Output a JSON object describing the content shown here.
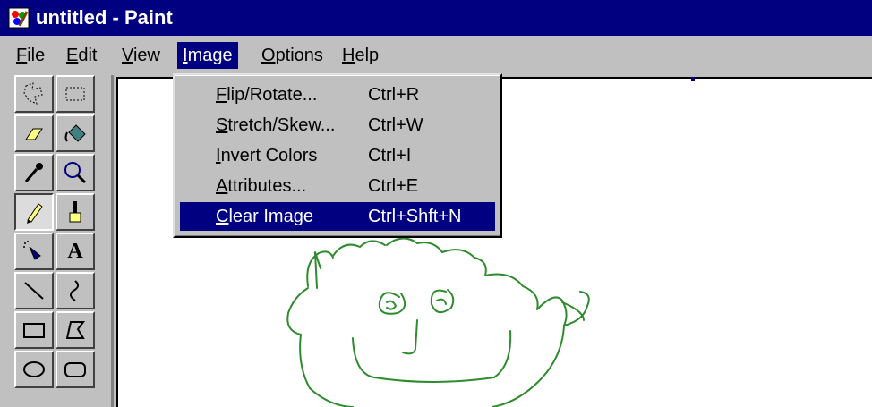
{
  "window": {
    "title": "untitled - Paint"
  },
  "menubar": {
    "items": [
      {
        "label": "File",
        "mnemonic": "F",
        "rest": "ile"
      },
      {
        "label": "Edit",
        "mnemonic": "E",
        "rest": "dit"
      },
      {
        "label": "View",
        "mnemonic": "V",
        "rest": "iew"
      },
      {
        "label": "Image",
        "mnemonic": "I",
        "rest": "mage"
      },
      {
        "label": "Options",
        "mnemonic": "O",
        "rest": "ptions"
      },
      {
        "label": "Help",
        "mnemonic": "H",
        "rest": "elp"
      }
    ]
  },
  "image_menu": {
    "items": [
      {
        "mnemonic": "F",
        "rest": "lip/Rotate...",
        "shortcut": "Ctrl+R"
      },
      {
        "mnemonic": "S",
        "rest": "tretch/Skew...",
        "shortcut": "Ctrl+W"
      },
      {
        "mnemonic": "I",
        "rest": "nvert Colors",
        "shortcut": "Ctrl+I"
      },
      {
        "mnemonic": "A",
        "rest": "ttributes...",
        "shortcut": "Ctrl+E"
      },
      {
        "mnemonic": "C",
        "rest": "lear Image",
        "shortcut": "Ctrl+Shft+N"
      }
    ],
    "selected": "Clear Image"
  },
  "toolbox": {
    "tools": [
      {
        "name": "free-form-select-icon"
      },
      {
        "name": "rectangle-select-icon"
      },
      {
        "name": "eraser-icon"
      },
      {
        "name": "fill-bucket-icon"
      },
      {
        "name": "pick-color-icon"
      },
      {
        "name": "magnifier-icon"
      },
      {
        "name": "pencil-icon",
        "active": true
      },
      {
        "name": "brush-icon"
      },
      {
        "name": "airbrush-icon"
      },
      {
        "name": "text-icon",
        "glyph": "A"
      },
      {
        "name": "line-icon"
      },
      {
        "name": "curve-icon"
      },
      {
        "name": "rectangle-icon"
      },
      {
        "name": "polygon-icon"
      },
      {
        "name": "ellipse-icon"
      },
      {
        "name": "rounded-rectangle-icon"
      }
    ]
  },
  "colors": {
    "titlebar": "#000080",
    "chrome": "#c0c0c0",
    "highlight": "#000080",
    "drawing": "#228b22"
  }
}
